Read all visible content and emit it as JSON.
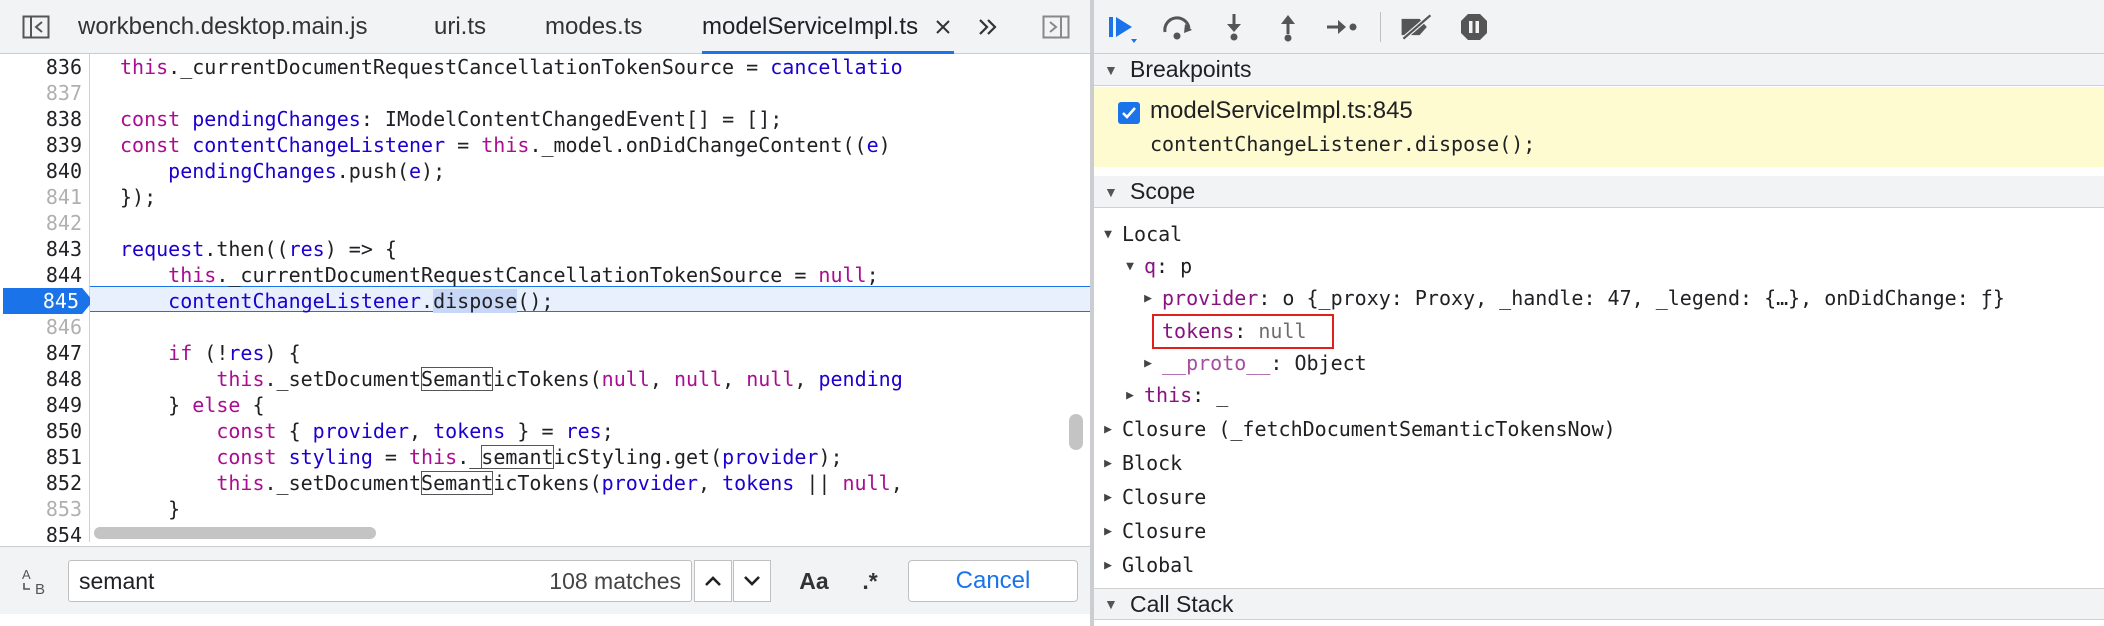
{
  "editor": {
    "tabs": [
      {
        "label": "workbench.desktop.main.js"
      },
      {
        "label": "uri.ts"
      },
      {
        "label": "modes.ts"
      },
      {
        "label": "modelServiceImpl.ts",
        "active": true
      }
    ],
    "close_glyph": "×",
    "more_glyph": "»",
    "lines": [
      {
        "num": "836",
        "faint": false
      },
      {
        "num": "837",
        "faint": true
      },
      {
        "num": "838",
        "faint": false
      },
      {
        "num": "839",
        "faint": false
      },
      {
        "num": "840",
        "faint": false
      },
      {
        "num": "841",
        "faint": true
      },
      {
        "num": "842",
        "faint": true
      },
      {
        "num": "843",
        "faint": false
      },
      {
        "num": "844",
        "faint": false
      },
      {
        "num": "845",
        "faint": false
      },
      {
        "num": "846",
        "faint": true
      },
      {
        "num": "847",
        "faint": false
      },
      {
        "num": "848",
        "faint": false
      },
      {
        "num": "849",
        "faint": false
      },
      {
        "num": "850",
        "faint": false
      },
      {
        "num": "851",
        "faint": false
      },
      {
        "num": "852",
        "faint": false
      },
      {
        "num": "853",
        "faint": true
      },
      {
        "num": "854",
        "faint": false
      }
    ],
    "code": {
      "l836": "this._currentDocumentRequestCancellationTokenSource = cancellatio",
      "l838": "const pendingChanges: IModelContentChangedEvent[] = [];",
      "l839": "const contentChangeListener = this._model.onDidChangeContent((e)",
      "l840": "    pendingChanges.push(e);",
      "l841": "});",
      "l843": "request.then((res) => {",
      "l844": "    this._currentDocumentRequestCancellationTokenSource = null;",
      "l845": "    contentChangeListener.dispose();",
      "l847": "    if (!res) {",
      "l848": "        this._setDocumentSemanticTokens(null, null, null, pending",
      "l849": "    } else {",
      "l850": "        const { provider, tokens } = res;",
      "l851": "        const styling = this._semanticStyling.get(provider);",
      "l852": "        this._setDocumentSemanticTokens(provider, tokens || null,",
      "l853": "    }"
    },
    "paused_line": "845"
  },
  "search": {
    "value": "semant",
    "match_count": "108 matches",
    "case_label": "Aa",
    "regex_label": ".*",
    "cancel_label": "Cancel"
  },
  "debugger": {
    "breakpoints": {
      "header": "Breakpoints",
      "item_file": "modelServiceImpl.ts:845",
      "item_code": "contentChangeListener.dispose();",
      "checked": true
    },
    "scope": {
      "header": "Scope",
      "local": "Local",
      "q_key": "q",
      "q_val": "p",
      "provider_key": "provider",
      "provider_val": "o {_proxy: Proxy, _handle: 47, _legend: {…}, onDidChange: ƒ}",
      "tokens_key": "tokens",
      "tokens_val": "null",
      "proto_key": "__proto__",
      "proto_val": "Object",
      "this_key": "this",
      "this_val": "_",
      "closure1": "Closure (_fetchDocumentSemanticTokensNow)",
      "block": "Block",
      "closure2": "Closure",
      "closure3": "Closure",
      "global": "Global"
    },
    "callstack": {
      "header": "Call Stack"
    }
  },
  "colors": {
    "accent": "#1a73e8",
    "breakpoint_bg": "#fefbd1",
    "highlight_box": "#e0201b"
  }
}
